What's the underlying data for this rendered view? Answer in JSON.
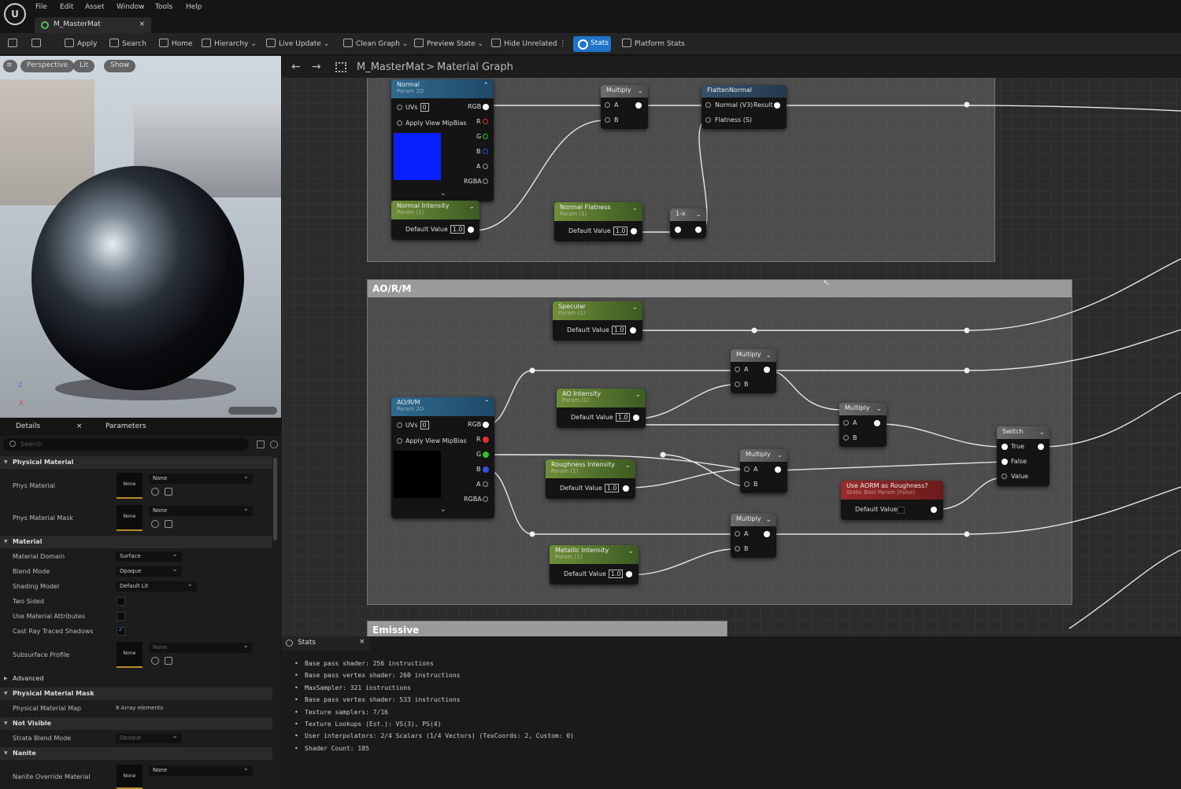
{
  "menu": {
    "logo": "U",
    "items": [
      "File",
      "Edit",
      "Asset",
      "Window",
      "Tools",
      "Help"
    ]
  },
  "tab": {
    "title": "M_MasterMat",
    "close": "×"
  },
  "toolbar": {
    "apply": "Apply",
    "search": "Search",
    "home": "Home",
    "hierarchy": "Hierarchy",
    "live_update": "Live Update",
    "clean_graph": "Clean Graph",
    "preview_state": "Preview State",
    "hide_unrelated": "Hide Unrelated",
    "stats": "Stats",
    "platform_stats": "Platform Stats"
  },
  "viewport": {
    "perspective": "Perspective",
    "lit": "Lit",
    "show": "Show",
    "axis_x": "X",
    "axis_z": "Z"
  },
  "details": {
    "tab_details": "Details",
    "tab_parameters": "Parameters",
    "search_placeholder": "Search",
    "sections": {
      "physical_material": "Physical Material",
      "material": "Material",
      "advanced": "Advanced",
      "physical_material_mask": "Physical Material Mask",
      "not_visible": "Not Visible",
      "nanite": "Nanite"
    },
    "props": {
      "phys_material": "Phys Material",
      "phys_material_mask": "Phys Material Mask",
      "material_domain": "Material Domain",
      "blend_mode": "Blend Mode",
      "shading_model": "Shading Model",
      "two_sided": "Two Sided",
      "use_material_attributes": "Use Material Attributes",
      "cast_ray_traced_shadows": "Cast Ray Traced Shadows",
      "subsurface_profile": "Subsurface Profile",
      "physical_material_map": "Physical Material Map",
      "strata_blend_mode": "Strata Blend Mode",
      "nanite_override_material": "Nanite Override Material"
    },
    "values": {
      "none": "None",
      "surface": "Surface",
      "opaque": "Opaque",
      "default_lit": "Default Lit",
      "array_elements": "8 Array elements"
    }
  },
  "graph": {
    "breadcrumb_asset": "M_MasterMat",
    "breadcrumb_sep": ">",
    "breadcrumb_graph": "Material Graph",
    "comment_aorm": "AO/R/M",
    "comment_emissive": "Emissive",
    "nodes": {
      "normal": {
        "title": "Normal",
        "sub": "Param 2D"
      },
      "normal_intensity": {
        "title": "Normal Intensity",
        "sub": "Param (1)"
      },
      "normal_flatness": {
        "title": "Normal Flatness",
        "sub": "Param (1)"
      },
      "one_minus": {
        "title": "1-x"
      },
      "flatten_normal": {
        "title": "FlattenNormal",
        "in1": "Normal (V3)",
        "out": "Result",
        "in2": "Flatness (S)"
      },
      "aorm": {
        "title": "AO/R/M",
        "sub": "Param 2D"
      },
      "specular": {
        "title": "Specular",
        "sub": "Param (1)"
      },
      "ao_intensity": {
        "title": "AO Intensity",
        "sub": "Param (1)"
      },
      "roughness_intensity": {
        "title": "Roughness Intensity",
        "sub": "Param (1)"
      },
      "metallic_intensity": {
        "title": "Metallic Intensity",
        "sub": "Param (1)"
      },
      "use_aorm": {
        "title": "Use AORM as Roughness?",
        "sub": "Static Bool Param (False)",
        "label": "Default Value"
      },
      "switch": {
        "title": "Switch",
        "true": "True",
        "false": "False",
        "value": "Value"
      },
      "multiply": "Multiply"
    },
    "pins": {
      "uvs": "UVs",
      "uv_val": "0",
      "apply_mip": "Apply View MipBias",
      "rgb": "RGB",
      "r": "R",
      "g": "G",
      "b": "B",
      "a": "A",
      "rgba": "RGBA",
      "default_value": "Default Value",
      "one": "1.0"
    },
    "colors": {
      "normal_swatch": "#0a1fff",
      "aorm_swatch": "#000000"
    }
  },
  "stats": {
    "tab": "Stats",
    "close": "×",
    "lines": [
      "Base pass shader: 256 instructions",
      "Base pass vertex shader: 260 instructions",
      "MaxSampler: 321 instructions",
      "Base pass vertex shader: 533 instructions",
      "Texture samplers: 7/16",
      "Texture Lookups (Est.): VS(3), PS(4)",
      "User interpolators: 2/4 Scalars (1/4 Vectors) (TexCoords: 2, Custom: 0)",
      "Shader Count: 185"
    ]
  }
}
